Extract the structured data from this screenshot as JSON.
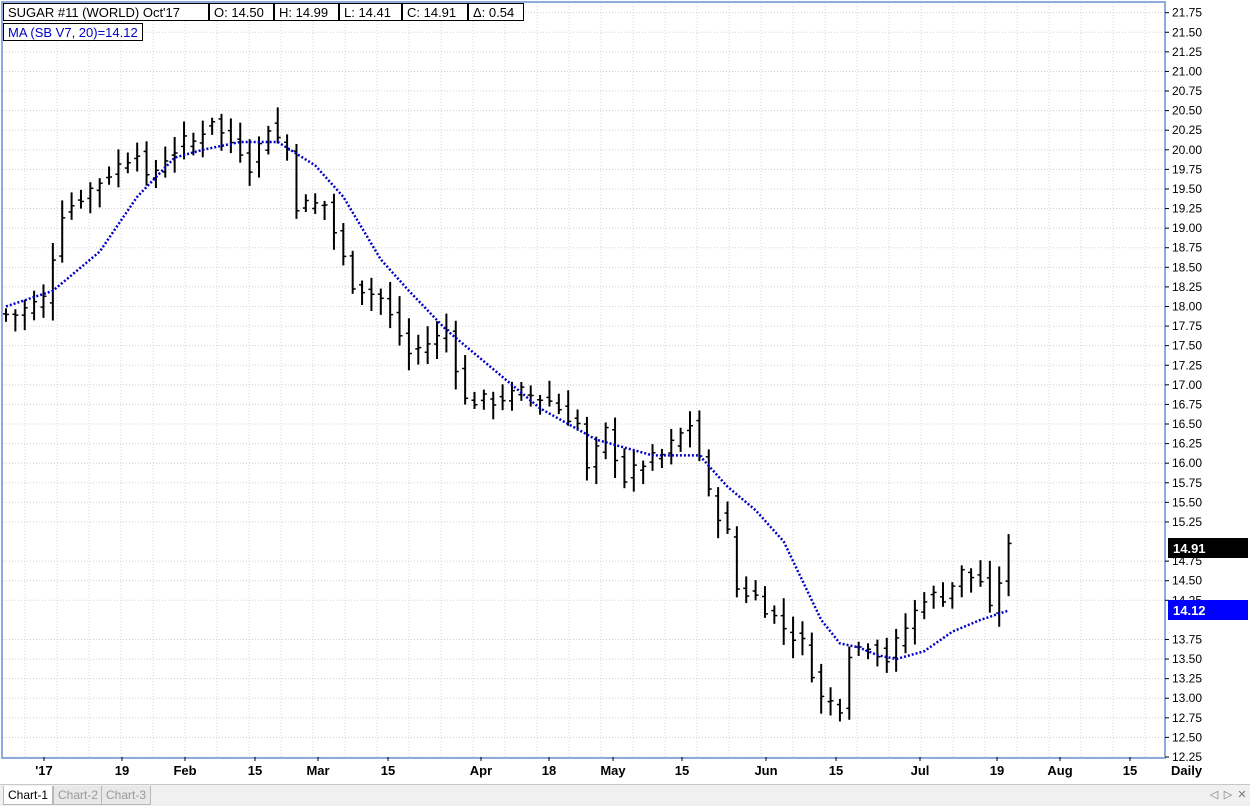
{
  "header": {
    "symbol": "SUGAR #11 (WORLD) Oct'17",
    "open": "O: 14.50",
    "high": "H: 14.99",
    "low": "L: 14.41",
    "close": "C: 14.91",
    "change": "Δ: 0.54",
    "ma": "MA (SB V7, 20)=14.12"
  },
  "tabs": [
    "Chart-1",
    "Chart-2",
    "Chart-3"
  ],
  "colors": {
    "frame": "#8faadc",
    "ma": "#0000c8",
    "last_price_bg": "#000000",
    "ma_price_bg": "#0000ff"
  },
  "chart_data": {
    "type": "ohlc_bar",
    "periodicity": "Daily",
    "y_ticks": [
      "21.75",
      "21.50",
      "21.25",
      "21.00",
      "20.75",
      "20.50",
      "20.25",
      "20.00",
      "19.75",
      "19.50",
      "19.25",
      "19.00",
      "18.75",
      "18.50",
      "18.25",
      "18.00",
      "17.75",
      "17.50",
      "17.25",
      "17.00",
      "16.75",
      "16.50",
      "16.25",
      "16.00",
      "15.75",
      "15.50",
      "15.25",
      "14.75",
      "14.50",
      "14.25",
      "13.75",
      "13.50",
      "13.25",
      "13.00",
      "12.75",
      "12.50",
      "12.25"
    ],
    "x_labels": [
      "'17",
      "19",
      "Feb",
      "15",
      "Mar",
      "15",
      "Apr",
      "18",
      "May",
      "15",
      "Jun",
      "15",
      "Jul",
      "19",
      "Aug",
      "15"
    ],
    "last_price": "14.91",
    "ma_value": "14.12",
    "ylim": [
      12.25,
      21.85
    ],
    "bar_anchors": [
      [
        1,
        17.9
      ],
      [
        4,
        18.1
      ],
      [
        6,
        19.2
      ],
      [
        9,
        19.5
      ],
      [
        11,
        19.7
      ],
      [
        14,
        20.0
      ],
      [
        15,
        19.6
      ],
      [
        17,
        19.9
      ],
      [
        19,
        20.1
      ],
      [
        20,
        20.1
      ],
      [
        22,
        20.4
      ],
      [
        23,
        20.2
      ],
      [
        25,
        20.0
      ],
      [
        26,
        19.8
      ],
      [
        28,
        20.3
      ],
      [
        30,
        20.0
      ],
      [
        31,
        19.3
      ],
      [
        34,
        19.3
      ],
      [
        36,
        18.6
      ],
      [
        37,
        18.3
      ],
      [
        40,
        18.1
      ],
      [
        43,
        17.4
      ],
      [
        46,
        17.6
      ],
      [
        47,
        17.7
      ],
      [
        49,
        16.8
      ],
      [
        52,
        16.8
      ],
      [
        55,
        16.9
      ],
      [
        58,
        16.8
      ],
      [
        61,
        16.5
      ],
      [
        62,
        15.9
      ],
      [
        64,
        16.4
      ],
      [
        66,
        15.8
      ],
      [
        68,
        16.0
      ],
      [
        70,
        16.1
      ],
      [
        73,
        16.5
      ],
      [
        74,
        16.1
      ],
      [
        75,
        15.6
      ],
      [
        77,
        15.1
      ],
      [
        78,
        14.4
      ],
      [
        80,
        14.3
      ],
      [
        83,
        13.9
      ],
      [
        85,
        13.7
      ],
      [
        87,
        13.0
      ],
      [
        89,
        12.9
      ],
      [
        90,
        13.6
      ],
      [
        92,
        13.7
      ],
      [
        94,
        13.5
      ],
      [
        96,
        13.9
      ],
      [
        98,
        14.3
      ],
      [
        100,
        14.3
      ],
      [
        102,
        14.6
      ],
      [
        104,
        14.5
      ],
      [
        105,
        14.1
      ],
      [
        107,
        14.91
      ]
    ],
    "ma_anchors": [
      [
        0,
        18.0
      ],
      [
        5,
        18.2
      ],
      [
        10,
        18.7
      ],
      [
        14,
        19.4
      ],
      [
        18,
        19.9
      ],
      [
        21,
        20.0
      ],
      [
        25,
        20.1
      ],
      [
        29,
        20.1
      ],
      [
        33,
        19.8
      ],
      [
        36,
        19.4
      ],
      [
        38,
        19.0
      ],
      [
        40,
        18.6
      ],
      [
        43,
        18.2
      ],
      [
        47,
        17.7
      ],
      [
        51,
        17.3
      ],
      [
        54,
        17.0
      ],
      [
        57,
        16.7
      ],
      [
        60,
        16.5
      ],
      [
        63,
        16.3
      ],
      [
        66,
        16.2
      ],
      [
        69,
        16.1
      ],
      [
        72,
        16.1
      ],
      [
        74,
        16.1
      ],
      [
        77,
        15.7
      ],
      [
        80,
        15.4
      ],
      [
        83,
        15.0
      ],
      [
        85,
        14.5
      ],
      [
        87,
        14.0
      ],
      [
        89,
        13.7
      ],
      [
        91,
        13.65
      ],
      [
        93,
        13.55
      ],
      [
        95,
        13.5
      ],
      [
        98,
        13.6
      ],
      [
        101,
        13.85
      ],
      [
        104,
        14.0
      ],
      [
        107,
        14.12
      ]
    ]
  }
}
